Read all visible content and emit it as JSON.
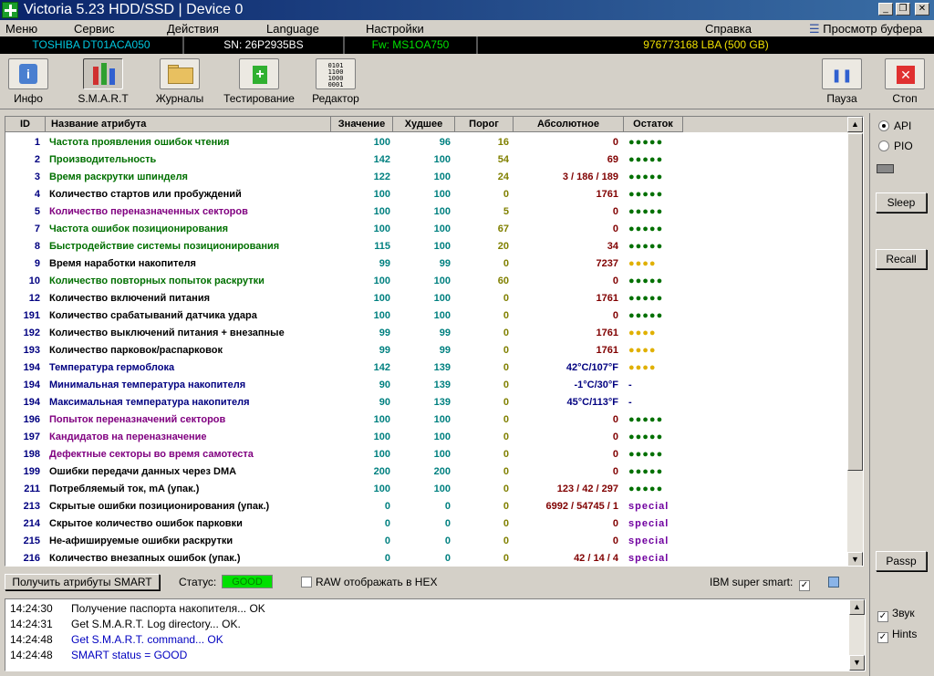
{
  "window": {
    "title": "Victoria 5.23 HDD/SSD | Device 0"
  },
  "menu": [
    "Меню",
    "Сервис",
    "Действия",
    "Language",
    "Настройки",
    "Справка",
    "Просмотр буфера"
  ],
  "device": {
    "model": "TOSHIBA DT01ACA050",
    "serial": "SN: 26P2935BS",
    "firmware": "Fw: MS1OA750",
    "capacity": "976773168 LBA (500 GB)"
  },
  "toolbar": {
    "info": "Инфо",
    "smart": "S.M.A.R.T",
    "logs": "Журналы",
    "test": "Тестирование",
    "editor": "Редактор",
    "pause": "Пауза",
    "stop": "Стоп"
  },
  "table": {
    "headers": {
      "id": "ID",
      "name": "Название атрибута",
      "value": "Значение",
      "worst": "Худшее",
      "threshold": "Порог",
      "absolute": "Абсолютное",
      "remaining": "Остаток"
    },
    "rows": [
      {
        "id": "1",
        "name": "Частота проявления ошибок чтения",
        "value": "100",
        "worst": "96",
        "thr": "16",
        "abs": "0",
        "rem": "●●●●●",
        "nc": "#007000",
        "rc": "#007000"
      },
      {
        "id": "2",
        "name": "Производительность",
        "value": "142",
        "worst": "100",
        "thr": "54",
        "abs": "69",
        "rem": "●●●●●",
        "nc": "#007000",
        "rc": "#007000"
      },
      {
        "id": "3",
        "name": "Время раскрутки шпинделя",
        "value": "122",
        "worst": "100",
        "thr": "24",
        "abs": "3 / 186 / 189",
        "rem": "●●●●●",
        "nc": "#007000",
        "rc": "#007000"
      },
      {
        "id": "4",
        "name": "Количество стартов или пробуждений",
        "value": "100",
        "worst": "100",
        "thr": "0",
        "abs": "1761",
        "rem": "●●●●●",
        "nc": "#000000",
        "rc": "#007000"
      },
      {
        "id": "5",
        "name": "Количество переназначенных секторов",
        "value": "100",
        "worst": "100",
        "thr": "5",
        "abs": "0",
        "rem": "●●●●●",
        "nc": "#800080",
        "rc": "#007000"
      },
      {
        "id": "7",
        "name": "Частота ошибок позиционирования",
        "value": "100",
        "worst": "100",
        "thr": "67",
        "abs": "0",
        "rem": "●●●●●",
        "nc": "#007000",
        "rc": "#007000"
      },
      {
        "id": "8",
        "name": "Быстродействие системы позиционирования",
        "value": "115",
        "worst": "100",
        "thr": "20",
        "abs": "34",
        "rem": "●●●●●",
        "nc": "#007000",
        "rc": "#007000"
      },
      {
        "id": "9",
        "name": "Время наработки накопителя",
        "value": "99",
        "worst": "99",
        "thr": "0",
        "abs": "7237",
        "rem": "●●●●",
        "nc": "#000000",
        "rc": "#e0b000"
      },
      {
        "id": "10",
        "name": "Количество повторных попыток раскрутки",
        "value": "100",
        "worst": "100",
        "thr": "60",
        "abs": "0",
        "rem": "●●●●●",
        "nc": "#007000",
        "rc": "#007000"
      },
      {
        "id": "12",
        "name": "Количество включений питания",
        "value": "100",
        "worst": "100",
        "thr": "0",
        "abs": "1761",
        "rem": "●●●●●",
        "nc": "#000000",
        "rc": "#007000"
      },
      {
        "id": "191",
        "name": "Количество срабатываний датчика удара",
        "value": "100",
        "worst": "100",
        "thr": "0",
        "abs": "0",
        "rem": "●●●●●",
        "nc": "#000000",
        "rc": "#007000"
      },
      {
        "id": "192",
        "name": "Количество выключений питания + внезапные",
        "value": "99",
        "worst": "99",
        "thr": "0",
        "abs": "1761",
        "rem": "●●●●",
        "nc": "#000000",
        "rc": "#e0b000"
      },
      {
        "id": "193",
        "name": "Количество парковок/распарковок",
        "value": "99",
        "worst": "99",
        "thr": "0",
        "abs": "1761",
        "rem": "●●●●",
        "nc": "#000000",
        "rc": "#e0b000"
      },
      {
        "id": "194",
        "name": "Температура гермоблока",
        "value": "142",
        "worst": "139",
        "thr": "0",
        "abs": "42°C/107°F",
        "rem": "●●●●",
        "nc": "#000080",
        "rc": "#e0b000",
        "ac": "#000080"
      },
      {
        "id": "194",
        "name": "Минимальная температура накопителя",
        "value": "90",
        "worst": "139",
        "thr": "0",
        "abs": "-1°C/30°F",
        "rem": "-",
        "nc": "#000080",
        "rc": "#000080",
        "ac": "#000080"
      },
      {
        "id": "194",
        "name": "Максимальная температура накопителя",
        "value": "90",
        "worst": "139",
        "thr": "0",
        "abs": "45°C/113°F",
        "rem": "-",
        "nc": "#000080",
        "rc": "#000080",
        "ac": "#000080"
      },
      {
        "id": "196",
        "name": "Попыток переназначений секторов",
        "value": "100",
        "worst": "100",
        "thr": "0",
        "abs": "0",
        "rem": "●●●●●",
        "nc": "#800080",
        "rc": "#007000"
      },
      {
        "id": "197",
        "name": "Кандидатов на переназначение",
        "value": "100",
        "worst": "100",
        "thr": "0",
        "abs": "0",
        "rem": "●●●●●",
        "nc": "#800080",
        "rc": "#007000"
      },
      {
        "id": "198",
        "name": "Дефектные секторы во время самотеста",
        "value": "100",
        "worst": "100",
        "thr": "0",
        "abs": "0",
        "rem": "●●●●●",
        "nc": "#800080",
        "rc": "#007000"
      },
      {
        "id": "199",
        "name": "Ошибки передачи данных через DMA",
        "value": "200",
        "worst": "200",
        "thr": "0",
        "abs": "0",
        "rem": "●●●●●",
        "nc": "#000000",
        "rc": "#007000"
      },
      {
        "id": "211",
        "name": "Потребляемый ток, mA (упак.)",
        "value": "100",
        "worst": "100",
        "thr": "0",
        "abs": "123 / 42 / 297",
        "rem": "●●●●●",
        "nc": "#000000",
        "rc": "#007000"
      },
      {
        "id": "213",
        "name": "Скрытые ошибки позиционирования (упак.)",
        "value": "0",
        "worst": "0",
        "thr": "0",
        "abs": "6992 / 54745 / 1",
        "rem": "special",
        "nc": "#000000",
        "rc": "#7000a0"
      },
      {
        "id": "214",
        "name": "Скрытое количество ошибок парковки",
        "value": "0",
        "worst": "0",
        "thr": "0",
        "abs": "0",
        "rem": "special",
        "nc": "#000000",
        "rc": "#7000a0"
      },
      {
        "id": "215",
        "name": "Не-афишируемые ошибки раскрутки",
        "value": "0",
        "worst": "0",
        "thr": "0",
        "abs": "0",
        "rem": "special",
        "nc": "#000000",
        "rc": "#7000a0"
      },
      {
        "id": "216",
        "name": "Количество внезапных ошибок (упак.)",
        "value": "0",
        "worst": "0",
        "thr": "0",
        "abs": "42 / 14 / 4",
        "rem": "special",
        "nc": "#000000",
        "rc": "#7000a0"
      }
    ]
  },
  "status": {
    "get_smart_label": "Получить атрибуты SMART",
    "status_label": "Статус:",
    "status_value": "GOOD",
    "raw_hex_label": "RAW отображать в HEX",
    "ibm_label": "IBM super smart:"
  },
  "right_panel": {
    "api_label": "API",
    "pio_label": "PIO",
    "sleep_label": "Sleep",
    "recall_label": "Recall",
    "passp_label": "Passp",
    "sound_label": "Звук",
    "hints_label": "Hints"
  },
  "log": [
    {
      "time": "14:24:30",
      "msg": "Получение паспорта накопителя... OK",
      "color": "#000000"
    },
    {
      "time": "14:24:31",
      "msg": "Get S.M.A.R.T. Log directory... OK.",
      "color": "#000000"
    },
    {
      "time": "14:24:48",
      "msg": "Get S.M.A.R.T. command... OK",
      "color": "#0000c0"
    },
    {
      "time": "14:24:48",
      "msg": "SMART status = GOOD",
      "color": "#0000c0"
    }
  ],
  "icons": {
    "app": "green-cross-icon",
    "info": "info-icon",
    "smart": "smart-bars-icon",
    "logs": "folder-icon",
    "test": "test-plus-icon",
    "editor": "binary-editor-icon",
    "pause": "pause-icon",
    "stop": "close-x-icon"
  }
}
